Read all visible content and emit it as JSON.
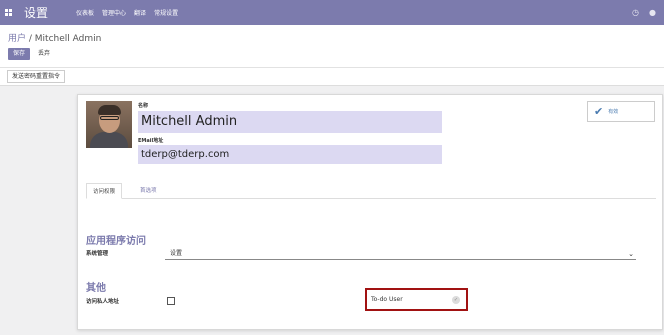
{
  "navbar": {
    "brand": "设置",
    "menu": [
      "仪表板",
      "管理中心",
      "翻译",
      "常规设置"
    ],
    "icons": [
      "clock-icon",
      "chat-icon"
    ]
  },
  "control_panel": {
    "breadcrumb_parent": "用户",
    "breadcrumb_separator": " / ",
    "breadcrumb_current": "Mitchell Admin",
    "save_label": "保存",
    "discard_label": "丢弃"
  },
  "action_bar": {
    "reset_password_label": "发送密码重置指令"
  },
  "form": {
    "name_label": "名称",
    "name_value": "Mitchell Admin",
    "email_label": "EMail地址",
    "email_value": "tderp@tderp.com",
    "active_label": "有效",
    "tabs": [
      "访问权限",
      "首选项"
    ],
    "section_apps": "应用程序访问",
    "system_admin_label": "系统管理",
    "system_admin_value": "设置",
    "section_other": "其他",
    "private_address_label": "访问私人地址",
    "private_address_checked": false,
    "todo_label": "To-do User",
    "todo_checked": true
  },
  "colors": {
    "navbar": "#7c7bad",
    "accent": "#7c7bad",
    "highlight_border": "#a11212",
    "field_bg": "#dcd9f2"
  }
}
